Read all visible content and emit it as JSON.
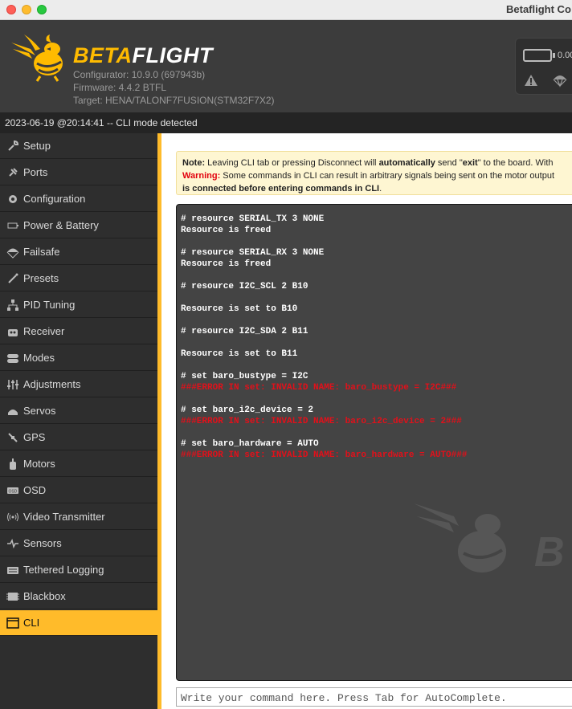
{
  "window": {
    "title": "Betaflight Co"
  },
  "header": {
    "brand_part1": "BETA",
    "brand_part2": "FLIGHT",
    "configurator": "Configurator: 10.9.0 (697943b)",
    "firmware": "Firmware: 4.4.2 BTFL",
    "target": "Target: HENA/TALONF7FUSION(STM32F7X2)",
    "voltage": "0.00"
  },
  "status": {
    "message": "2023-06-19 @20:14:41 -- CLI mode detected"
  },
  "sidebar": {
    "items": [
      {
        "label": "Setup",
        "icon": "wrench-icon"
      },
      {
        "label": "Ports",
        "icon": "plug-icon"
      },
      {
        "label": "Configuration",
        "icon": "gear-icon"
      },
      {
        "label": "Power & Battery",
        "icon": "battery-icon"
      },
      {
        "label": "Failsafe",
        "icon": "parachute-icon"
      },
      {
        "label": "Presets",
        "icon": "magic-wand-icon"
      },
      {
        "label": "PID Tuning",
        "icon": "pid-icon"
      },
      {
        "label": "Receiver",
        "icon": "receiver-icon"
      },
      {
        "label": "Modes",
        "icon": "toggle-icon"
      },
      {
        "label": "Adjustments",
        "icon": "sliders-icon"
      },
      {
        "label": "Servos",
        "icon": "servo-icon"
      },
      {
        "label": "GPS",
        "icon": "satellite-icon"
      },
      {
        "label": "Motors",
        "icon": "motor-icon"
      },
      {
        "label": "OSD",
        "icon": "osd-icon"
      },
      {
        "label": "Video Transmitter",
        "icon": "broadcast-icon"
      },
      {
        "label": "Sensors",
        "icon": "pulse-icon"
      },
      {
        "label": "Tethered Logging",
        "icon": "keyboard-icon"
      },
      {
        "label": "Blackbox",
        "icon": "blackbox-icon"
      },
      {
        "label": "CLI",
        "icon": "terminal-icon",
        "active": true
      }
    ]
  },
  "note": {
    "note_label": "Note:",
    "note_text1": " Leaving CLI tab or pressing Disconnect will ",
    "note_bold": "automatically",
    "note_text2": " send \"",
    "note_exit": "exit",
    "note_text3": "\" to the board. With",
    "warning_label": "Warning:",
    "warning_text": " Some commands in CLI can result in arbitrary signals being sent on the motor output",
    "warning_bold": "is connected before entering commands in CLI",
    "warning_end": "."
  },
  "cli": {
    "lines": [
      {
        "text": "# resource SERIAL_TX 3 NONE",
        "kind": "cmd"
      },
      {
        "text": "Resource is freed",
        "kind": "cmd"
      },
      {
        "text": "# resource SERIAL_RX 3 NONE",
        "kind": "cmd"
      },
      {
        "text": "Resource is freed",
        "kind": "cmd"
      },
      {
        "text": "# resource I2C_SCL 2 B10",
        "kind": "cmd"
      },
      {
        "text": "Resource is set to B10",
        "kind": "cmd"
      },
      {
        "text": "# resource I2C_SDA 2 B11",
        "kind": "cmd"
      },
      {
        "text": "Resource is set to B11",
        "kind": "cmd"
      },
      {
        "text": "# set baro_bustype = I2C",
        "kind": "cmd"
      },
      {
        "text": "###ERROR IN set: INVALID NAME: baro_bustype = I2C###",
        "kind": "err"
      },
      {
        "text": "# set baro_i2c_device = 2",
        "kind": "cmd"
      },
      {
        "text": "###ERROR IN set: INVALID NAME: baro_i2c_device = 2###",
        "kind": "err"
      },
      {
        "text": "# set baro_hardware = AUTO",
        "kind": "cmd"
      },
      {
        "text": "###ERROR IN set: INVALID NAME: baro_hardware = AUTO###",
        "kind": "err"
      }
    ],
    "input_placeholder": "Write your command here. Press Tab for AutoComplete."
  },
  "colors": {
    "accent": "#ffbb2a",
    "error": "#e2101a",
    "cli_bg": "#444444"
  }
}
